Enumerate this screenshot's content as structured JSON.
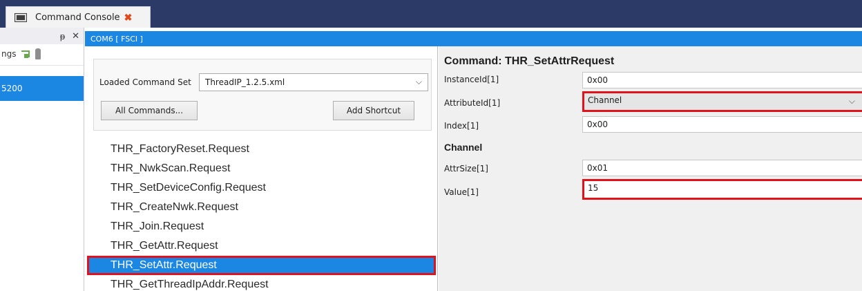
{
  "tab": {
    "title": "Command Console",
    "close_glyph": "✖"
  },
  "left_panel": {
    "pin_glyph": "ᵽ",
    "close_glyph": "✕",
    "toolbar_text": "ngs",
    "selected_item": "5200"
  },
  "com_bar": {
    "title": "COM6 [ FSCI ]"
  },
  "command_set": {
    "label": "Loaded Command Set",
    "value": "ThreadIP_1.2.5.xml",
    "all_commands_label": "All Commands...",
    "add_shortcut_label": "Add Shortcut"
  },
  "commands": [
    "THR_FactoryReset.Request",
    "THR_NwkScan.Request",
    "THR_SetDeviceConfig.Request",
    "THR_CreateNwk.Request",
    "THR_Join.Request",
    "THR_GetAttr.Request",
    "THR_SetAttr.Request",
    "THR_GetThreadIpAddr.Request"
  ],
  "selected_command_index": 6,
  "details": {
    "title": "Command: THR_SetAttrRequest",
    "instance_label": "InstanceId[1]",
    "instance_value": "0x00",
    "attribute_label": "AttributeId[1]",
    "attribute_value": "Channel",
    "index_label": "Index[1]",
    "index_value": "0x00",
    "section": "Channel",
    "attrsize_label": "AttrSize[1]",
    "attrsize_value": "0x01",
    "value_label": "Value[1]",
    "value_value": "15"
  },
  "colors": {
    "accent": "#1c86e3",
    "highlight_border": "#e0131c",
    "topbar": "#2b3a67"
  }
}
